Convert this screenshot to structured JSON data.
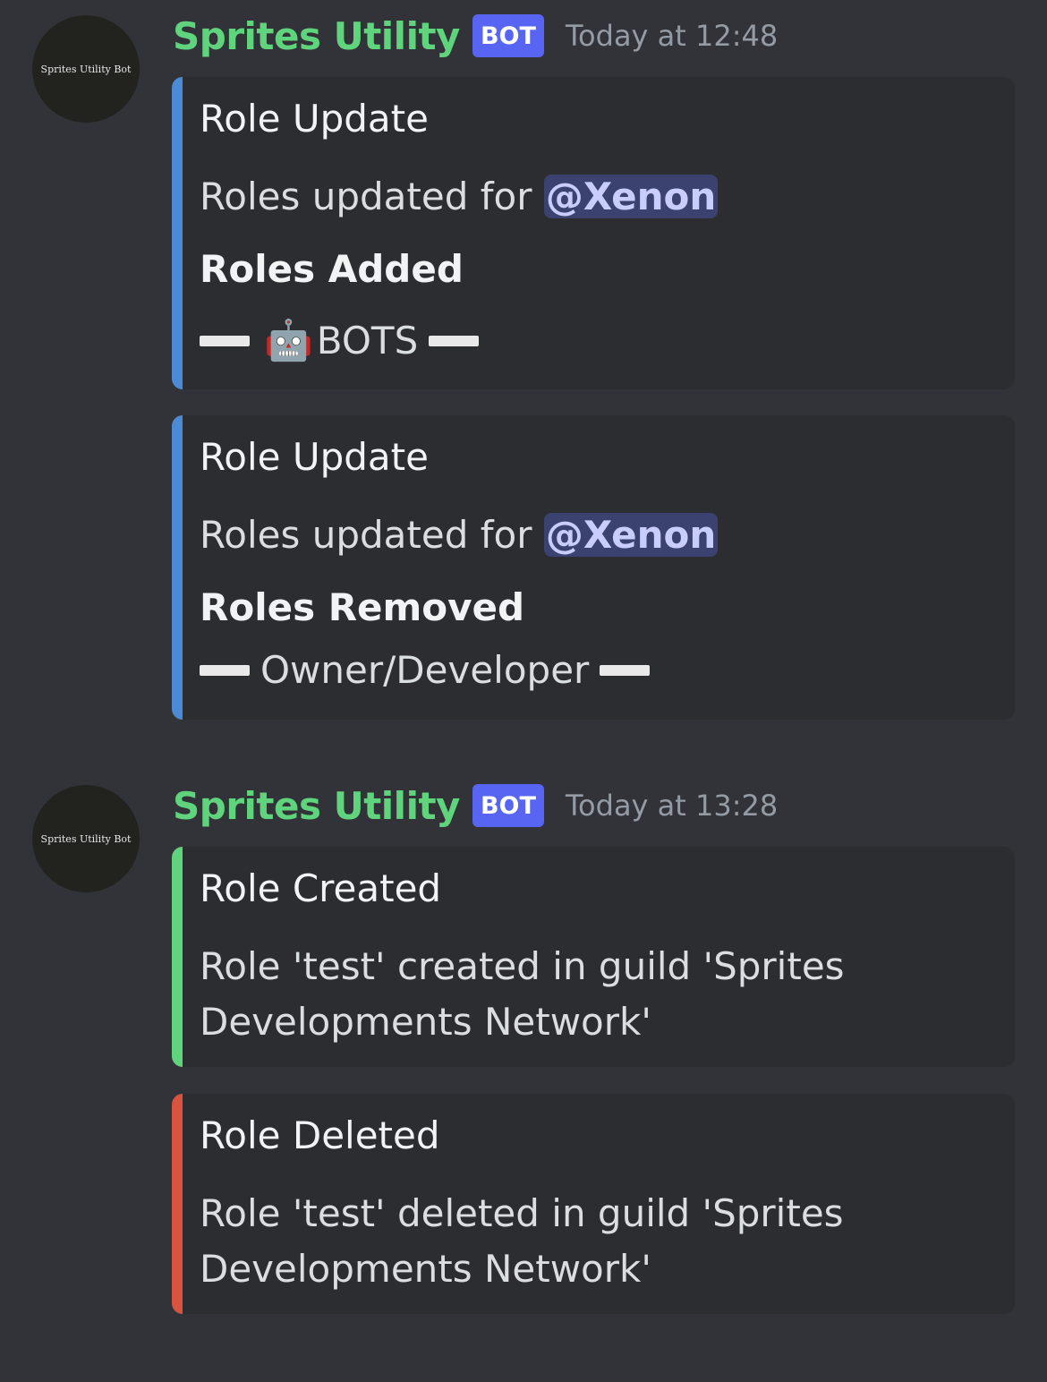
{
  "messages": [
    {
      "avatar_text": "Sprites Utility Bot",
      "username": "Sprites Utility",
      "bot_tag": "BOT",
      "timestamp": "Today at 12:48",
      "embeds": [
        {
          "color": "#4b8bd6",
          "title": "Role Update",
          "description_prefix": "Roles updated for",
          "mention": "@Xenon",
          "field_name": "Roles Added",
          "role_icon": "robot-face-icon",
          "role_value": "BOTS"
        },
        {
          "color": "#4b8bd6",
          "title": "Role Update",
          "description_prefix": "Roles updated for",
          "mention": "@Xenon",
          "field_name": "Roles Removed",
          "role_value": "Owner/Developer"
        }
      ]
    },
    {
      "avatar_text": "Sprites Utility Bot",
      "username": "Sprites Utility",
      "bot_tag": "BOT",
      "timestamp": "Today at 13:28",
      "embeds": [
        {
          "color": "#5fd47d",
          "title": "Role Created",
          "description_line1": "Role 'test' created in guild 'Sprites",
          "description_line2": "Developments Network'"
        },
        {
          "color": "#d9533f",
          "title": "Role Deleted",
          "description_line1": "Role 'test' deleted in guild 'Sprites",
          "description_line2": "Developments Network'"
        }
      ]
    }
  ]
}
